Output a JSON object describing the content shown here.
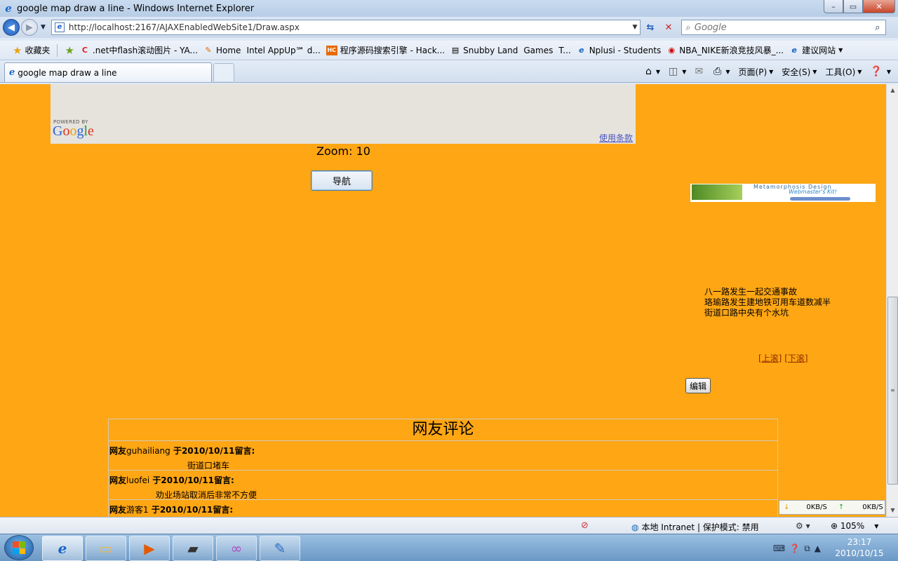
{
  "window": {
    "title": "google map draw a line - Windows Internet Explorer",
    "minimize": "–",
    "maximize": "▭",
    "close": "✕"
  },
  "address": {
    "url": "http://localhost:2167/AJAXEnabledWebSite1/Draw.aspx",
    "search_placeholder": "Google"
  },
  "favorites": {
    "label": "收藏夹",
    "items": [
      {
        "icon": "C",
        "label": ".net中flash滚动图片 - YA..."
      },
      {
        "icon": "✎",
        "label": "Home"
      },
      {
        "icon": "",
        "label": "Intel AppUp℠ d..."
      },
      {
        "icon": "HC",
        "label": "程序源码搜索引擎 - Hack..."
      },
      {
        "icon": "▤",
        "label": "Snubby Land"
      },
      {
        "icon": "",
        "label": "Games"
      },
      {
        "icon": "",
        "label": "T..."
      },
      {
        "icon": "e",
        "label": "Nplusi - Students"
      },
      {
        "icon": "◉",
        "label": "NBA_NIKE新浪竞技风暴_..."
      },
      {
        "icon": "e",
        "label": "建议网站"
      }
    ]
  },
  "tabs": [
    {
      "label": "google map draw a line"
    }
  ],
  "commands": {
    "page": "页面(P)",
    "safety": "安全(S)",
    "tools": "工具(O)"
  },
  "page": {
    "map": {
      "powered_by": "POWERED BY",
      "logo": [
        "G",
        "o",
        "o",
        "g",
        "l",
        "e"
      ],
      "terms": "使用条款"
    },
    "zoom_text": "Zoom: 10",
    "nav_button": "导航",
    "banner": {
      "line1": "Metamorphosis Design",
      "line2": "Webmaster's Kit!"
    },
    "news": [
      "八一路发生一起交通事故",
      "珞瑜路发生建地铁可用车道数减半",
      "街道口路中央有个水坑"
    ],
    "scroll_up": "[上滚]",
    "scroll_down": "[下滚]",
    "edit_button": "编辑",
    "comments": {
      "heading": "网友评论",
      "items": [
        {
          "prefix": "网友",
          "user": "guhailiang",
          "date": " 于2010/10/11留言:",
          "text": "街道口堵车"
        },
        {
          "prefix": "网友",
          "user": "luofei",
          "date": " 于2010/10/11留言:",
          "text": "劝业场站取消后非常不方便"
        },
        {
          "prefix": "网友",
          "user": "游客1",
          "date": " 于2010/10/11留言:",
          "text": ""
        }
      ]
    }
  },
  "netspeed": {
    "down": "0KB/S",
    "up": "0KB/S"
  },
  "status": {
    "zone": "本地 Intranet | 保护模式: 禁用",
    "zoom": "105%"
  },
  "clock": {
    "time": "23:17",
    "date": "2010/10/15"
  }
}
